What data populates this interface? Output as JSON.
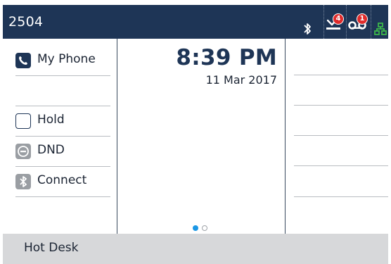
{
  "status_bar": {
    "extension": "2504",
    "icons": [
      "bluetooth-icon",
      "missed-calls-icon",
      "voicemail-icon",
      "network-icon"
    ],
    "missed_calls_count": "4",
    "voicemail_count": "1",
    "colors": {
      "bar": "#1e3556",
      "badge": "#e02b2b",
      "network": "#3db84a"
    }
  },
  "line_keys": [
    {
      "label": "My Phone",
      "icon": "phone-icon"
    },
    {
      "label": ""
    },
    {
      "label": "Hold",
      "icon": "blank-key-icon"
    },
    {
      "label": "DND",
      "icon": "dnd-icon"
    },
    {
      "label": "Connect",
      "icon": "bluetooth-icon"
    }
  ],
  "clock": {
    "time": "8:39 PM",
    "date": "11 Mar 2017"
  },
  "pager": {
    "pages": 2,
    "current": 1,
    "active_color": "#1b97e5"
  },
  "softkeys": [
    {
      "label": "Hot Desk"
    }
  ]
}
